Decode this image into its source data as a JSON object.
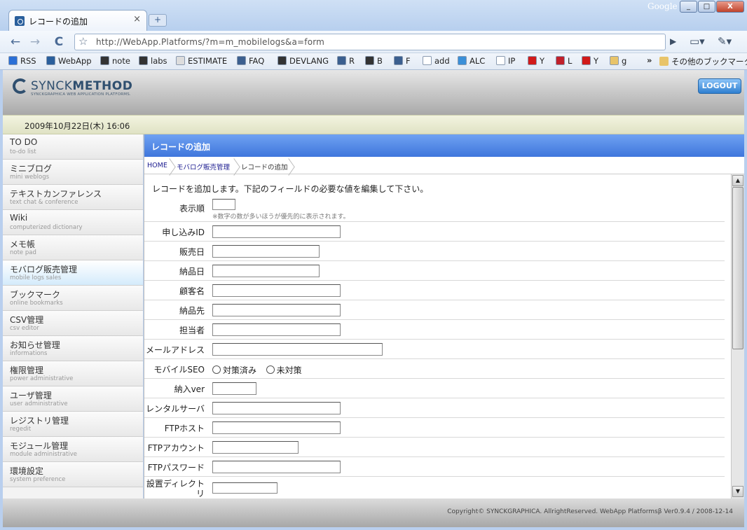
{
  "browser": {
    "tab_title": "レコードの追加",
    "tab_close": "×",
    "new_tab": "+",
    "google_label": "Google",
    "url": "http://WebApp.Platforms/?m=m_mobilelogs&a=form",
    "window_buttons": {
      "minimize": "_",
      "maximize": "□",
      "close": "X"
    },
    "nav": {
      "back": "←",
      "forward": "→",
      "reload": "C",
      "star": "☆",
      "go": "▶",
      "page_menu": "▭▾",
      "tool_menu": "✎▾"
    }
  },
  "bookmarks": [
    {
      "label": "RSS",
      "icon": "rss-icon",
      "color": "#2a6fd6"
    },
    {
      "label": "WebApp",
      "icon": "webapp-icon",
      "color": "#2a5f9c"
    },
    {
      "label": "note",
      "icon": "note-icon",
      "color": "#333333"
    },
    {
      "label": "labs",
      "icon": "labs-icon",
      "color": "#333333"
    },
    {
      "label": "ESTIMATE",
      "icon": "page-icon",
      "color": "#dddddd"
    },
    {
      "label": "FAQ",
      "icon": "reload-icon",
      "color": "#3b5f8f"
    },
    {
      "label": "DEVLANG",
      "icon": "w-icon",
      "color": "#333333"
    },
    {
      "label": "R",
      "icon": "reload-icon",
      "color": "#3b5f8f"
    },
    {
      "label": "B",
      "icon": "w-icon",
      "color": "#333333"
    },
    {
      "label": "F",
      "icon": "reload-icon",
      "color": "#3b5f8f"
    },
    {
      "label": "add",
      "icon": "page-icon",
      "color": "#ffffff"
    },
    {
      "label": "ALC",
      "icon": "alc-icon",
      "color": "#3a8fd8"
    },
    {
      "label": "IP",
      "icon": "page-icon",
      "color": "#ffffff"
    },
    {
      "label": "Y",
      "icon": "yahoo-icon",
      "color": "#d11a1a"
    },
    {
      "label": "L",
      "icon": "pdf-icon",
      "color": "#c0202a"
    },
    {
      "label": "Y",
      "icon": "youtube-icon",
      "color": "#d11a1a"
    },
    {
      "label": "g",
      "icon": "folder-icon",
      "color": "#e8c46a"
    }
  ],
  "bookmarks_more": "»",
  "bookmarks_other": "その他のブックマーク",
  "app": {
    "logo_word_light": "SYNCK",
    "logo_word_bold": "METHOD",
    "logo_tagline": "SYNCKGRAPHICA WEB APPLICATION PLATFORMS.",
    "logout": "LOGOUT",
    "date": "2009年10月22日(木) 16:06"
  },
  "sidebar": [
    {
      "jp": "TO DO",
      "en": "to-do list"
    },
    {
      "jp": "ミニブログ",
      "en": "mini weblogs"
    },
    {
      "jp": "テキストカンファレンス",
      "en": "text chat & conference"
    },
    {
      "jp": "Wiki",
      "en": "computerized dictionary"
    },
    {
      "jp": "メモ帳",
      "en": "note pad"
    },
    {
      "jp": "モバログ販売管理",
      "en": "mobile logs sales"
    },
    {
      "jp": "ブックマーク",
      "en": "online bookmarks"
    },
    {
      "jp": "CSV管理",
      "en": "csv editor"
    },
    {
      "jp": "お知らせ管理",
      "en": "informations"
    },
    {
      "jp": "権限管理",
      "en": "power administrative"
    },
    {
      "jp": "ユーザ管理",
      "en": "user administrative"
    },
    {
      "jp": "レジストリ管理",
      "en": "regedit"
    },
    {
      "jp": "モジュール管理",
      "en": "module administrative"
    },
    {
      "jp": "環境設定",
      "en": "system preference"
    }
  ],
  "main": {
    "title": "レコードの追加",
    "breadcrumbs": [
      "HOME",
      "モバログ販売管理",
      "レコードの追加"
    ],
    "intro": "レコードを追加します。下記のフィールドの必要な値を編集して下さい。",
    "order_hint": "※数字の数が多いほうが優先的に表示されます。",
    "fields": {
      "order": {
        "label": "表示順",
        "value": ""
      },
      "application_id": {
        "label": "申し込みID",
        "value": ""
      },
      "sale_date": {
        "label": "販売日",
        "value": ""
      },
      "delivery_date": {
        "label": "納品日",
        "value": ""
      },
      "customer_name": {
        "label": "顧客名",
        "value": ""
      },
      "delivery_to": {
        "label": "納品先",
        "value": ""
      },
      "person_in_charge": {
        "label": "担当者",
        "value": ""
      },
      "email": {
        "label": "メールアドレス",
        "value": ""
      },
      "mobile_seo": {
        "label": "モバイルSEO",
        "options": [
          "対策済み",
          "未対策"
        ]
      },
      "version": {
        "label": "納入ver",
        "value": ""
      },
      "rental_server": {
        "label": "レンタルサーバ",
        "value": ""
      },
      "ftp_host": {
        "label": "FTPホスト",
        "value": ""
      },
      "ftp_account": {
        "label": "FTPアカウント",
        "value": ""
      },
      "ftp_password": {
        "label": "FTPパスワード",
        "value": ""
      },
      "install_dir": {
        "label_line1": "設置ディレクト",
        "label_line2": "リ",
        "value": ""
      }
    }
  },
  "scrollbar": {
    "up": "▲",
    "down": "▼"
  },
  "footer": "Copyright© SYNCKGRAPHICA. AllrightReserved. WebApp Platformsβ Ver0.9.4 / 2008-12-14"
}
